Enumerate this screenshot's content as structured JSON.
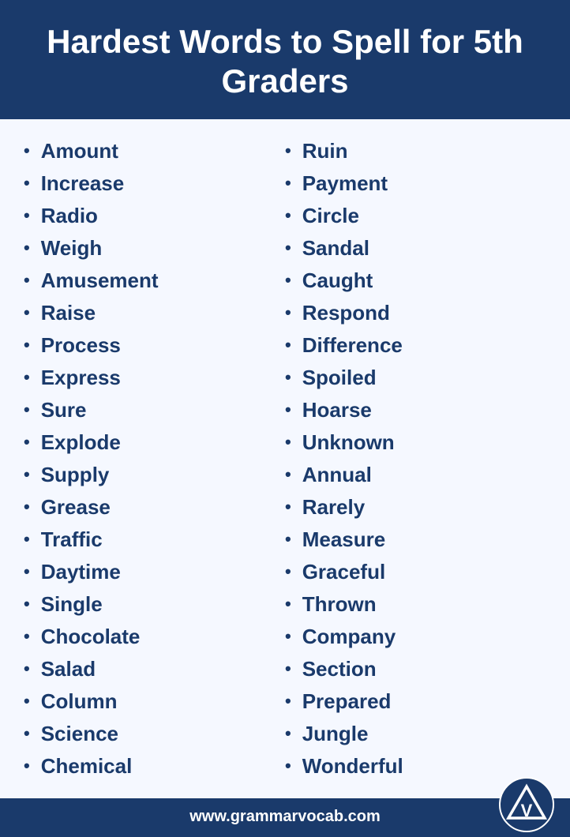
{
  "header": {
    "title": "Hardest Words to Spell for 5th Graders"
  },
  "columns": {
    "left": [
      "Amount",
      "Increase",
      "Radio",
      "Weigh",
      "Amusement",
      "Raise",
      "Process",
      "Express",
      "Sure",
      "Explode",
      "Supply",
      "Grease",
      "Traffic",
      "Daytime",
      "Single",
      "Chocolate",
      "Salad",
      "Column",
      "Science",
      "Chemical"
    ],
    "right": [
      "Ruin",
      "Payment",
      "Circle",
      "Sandal",
      "Caught",
      "Respond",
      "Difference",
      "Spoiled",
      "Hoarse",
      "Unknown",
      "Annual",
      "Rarely",
      "Measure",
      "Graceful",
      "Thrown",
      "Company",
      "Section",
      "Prepared",
      "Jungle",
      "Wonderful"
    ]
  },
  "footer": {
    "url": "www.grammarvocab.com"
  }
}
